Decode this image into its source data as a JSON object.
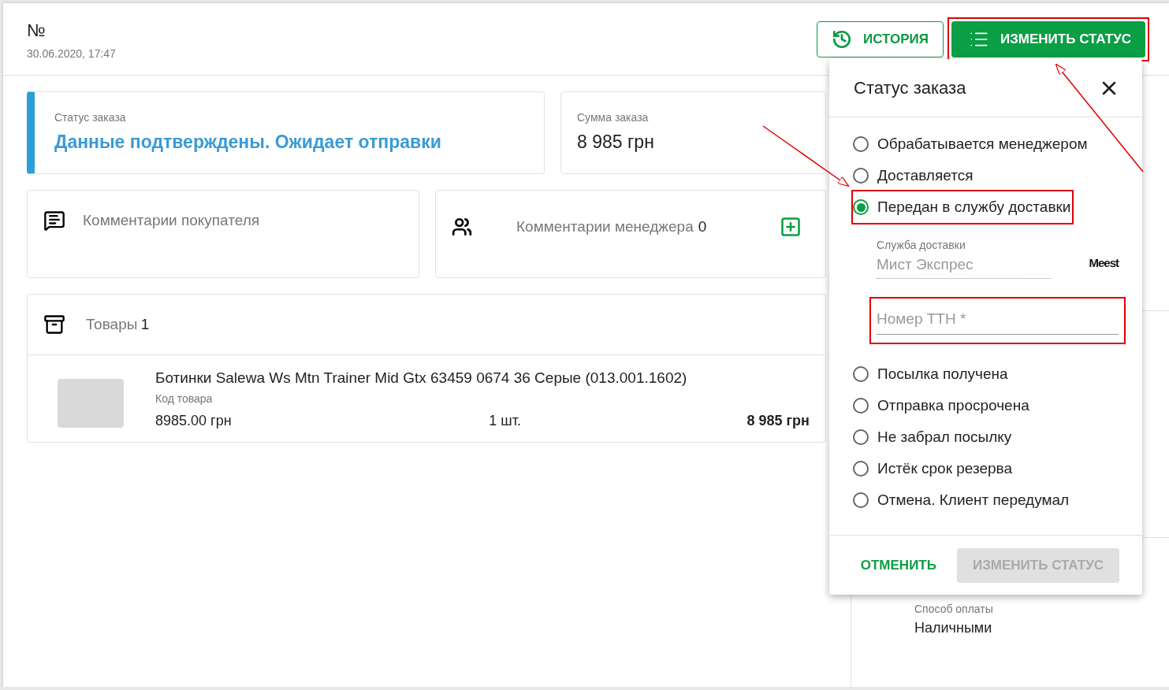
{
  "header": {
    "title": "№",
    "date": "30.06.2020, 17:47",
    "history_button": "ИСТОРИЯ",
    "change_status_button": {
      "label": "ИЗМЕНИТЬ СТАТУС",
      "highlighted": true
    }
  },
  "status_card": {
    "label": "Статус заказа",
    "value": "Данные подтверждены. Ожидает отправки"
  },
  "sum_card": {
    "label": "Сумма заказа",
    "value": "8 985 грн"
  },
  "buyer_comments": {
    "title": "Комментарии покупателя"
  },
  "manager_comments": {
    "title": "Комментарии менеджера",
    "count": "0"
  },
  "products": {
    "title": "Товары",
    "count": "1",
    "items": [
      {
        "name": "Ботинки Salewa Ws Mtn Trainer Mid Gtx 63459 0674 36 Серые (013.001.1602)",
        "code_label": "Код товара",
        "price": "8985.00 грн",
        "quantity": "1 шт.",
        "total": "8 985 грн"
      }
    ]
  },
  "sidebar": {
    "payment_label": "Способ оплаты",
    "payment_value": "Наличными"
  },
  "status_popup": {
    "title": "Статус заказа",
    "options": [
      {
        "label": "Обрабатывается менеджером",
        "selected": false,
        "highlighted": false
      },
      {
        "label": "Доставляется",
        "selected": false,
        "highlighted": false
      },
      {
        "label": "Передан в службу доставки",
        "selected": true,
        "highlighted": true
      },
      {
        "label": "Посылка получена",
        "selected": false,
        "highlighted": false
      },
      {
        "label": "Отправка просрочена",
        "selected": false,
        "highlighted": false
      },
      {
        "label": "Не забрал посылку",
        "selected": false,
        "highlighted": false
      },
      {
        "label": "Истёк срок резерва",
        "selected": false,
        "highlighted": false
      },
      {
        "label": "Отмена. Клиент передумал",
        "selected": false,
        "highlighted": false
      }
    ],
    "delivery": {
      "service_label": "Служба доставки",
      "service_value": "Мист Экспрес",
      "logo": "Meest",
      "ttn_placeholder": "Номер ТТН *",
      "ttn_highlighted": true
    },
    "cancel_button": "ОТМЕНИТЬ",
    "submit_button": {
      "label": "ИЗМЕНИТЬ СТАТУС",
      "disabled": true
    }
  }
}
